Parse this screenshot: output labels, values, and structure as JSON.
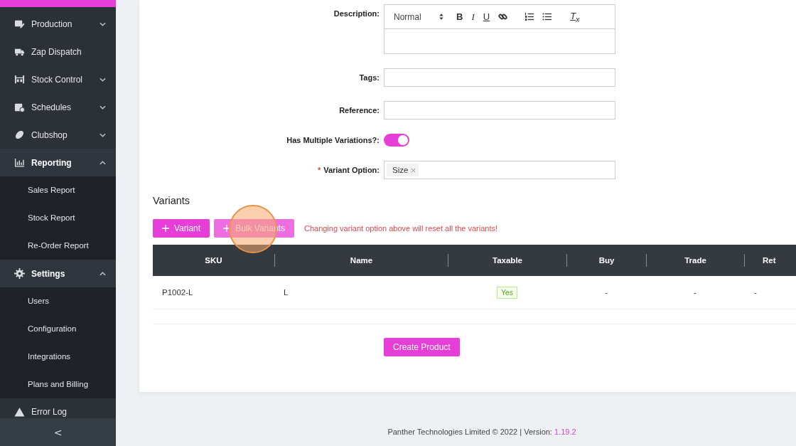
{
  "sidebar": {
    "items": [
      {
        "kind": "production",
        "label": "Production",
        "expanded": false,
        "has_children": true
      },
      {
        "kind": "truck",
        "label": "Zap Dispatch",
        "expanded": false,
        "has_children": false
      },
      {
        "kind": "warehouse",
        "label": "Stock Control",
        "expanded": false,
        "has_children": true
      },
      {
        "kind": "calendar",
        "label": "Schedules",
        "expanded": false,
        "has_children": true
      },
      {
        "kind": "ball",
        "label": "Clubshop",
        "expanded": false,
        "has_children": true
      },
      {
        "kind": "chart",
        "label": "Reporting",
        "expanded": true,
        "has_children": true,
        "children": [
          {
            "label": "Sales Report"
          },
          {
            "label": "Stock Report"
          },
          {
            "label": "Re-Order Report"
          }
        ]
      },
      {
        "kind": "gear",
        "label": "Settings",
        "expanded": true,
        "has_children": true,
        "children": [
          {
            "label": "Users"
          },
          {
            "label": "Configuration"
          },
          {
            "label": "Integrations"
          },
          {
            "label": "Plans and Billing"
          }
        ]
      },
      {
        "kind": "warning",
        "label": "Error Log",
        "expanded": false,
        "has_children": false
      }
    ],
    "collapse": "<"
  },
  "form": {
    "description": {
      "label": "Description:",
      "format": "Normal",
      "toolbar": [
        {
          "kind": "bold",
          "glyph": "B"
        },
        {
          "kind": "italic",
          "glyph": "I"
        },
        {
          "kind": "underline",
          "glyph": "U"
        },
        {
          "kind": "link"
        },
        {
          "kind": "ordered-list"
        },
        {
          "kind": "bullet-list"
        },
        {
          "kind": "clear",
          "glyph": "T$_{x}$"
        }
      ]
    },
    "tags": {
      "label": "Tags:"
    },
    "reference": {
      "label": "Reference:"
    },
    "multiple_variations": {
      "label": "Has Multiple Variations?:",
      "on": true
    },
    "variant_option": {
      "label": "Variant Option:",
      "required_mark": "*",
      "tags": [
        "Size"
      ]
    }
  },
  "variants": {
    "heading": "Variants",
    "buttons": [
      {
        "label": "Variant",
        "faded": false
      },
      {
        "label": "Bulk Variants",
        "faded": true
      }
    ],
    "warning": "Changing variant option above will reset all the variants!",
    "table": {
      "columns": [
        "SKU",
        "Name",
        "Taxable",
        "Buy",
        "Trade",
        "Ret"
      ],
      "rows": [
        {
          "sku": "P1002-L",
          "name": "L",
          "taxable": "Yes",
          "buy": "-",
          "trade": "-",
          "retail": "-"
        }
      ]
    }
  },
  "submit": "Create Product",
  "footer": {
    "text": "Panther Technologies Limited © 2022 | Version:",
    "version": "1.19.2"
  }
}
